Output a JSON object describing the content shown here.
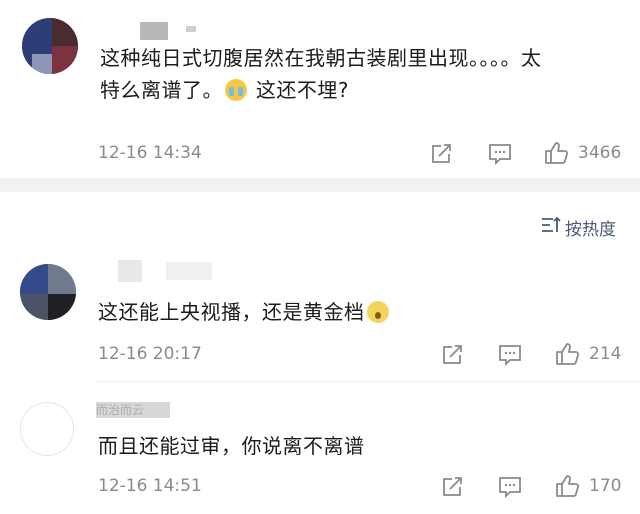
{
  "sort": {
    "label": "按热度"
  },
  "comments": [
    {
      "text_line1": "这种纯日式切腹居然在我朝古装剧里出现。。。。太",
      "text_line2a": "特么离谱了。",
      "text_line2b": " 这还不埋?",
      "time": "12-16 14:34",
      "likes": "3466"
    },
    {
      "text": "这还能上央视播，还是黄金档",
      "time": "12-16 20:17",
      "likes": "214"
    },
    {
      "username_partial": "而治而云",
      "text": "而且还能过审，你说离不离谱",
      "time": "12-16 14:51",
      "likes": "170"
    }
  ],
  "icons": {
    "share": "share-icon",
    "comment": "comment-icon",
    "like": "thumbs-up-icon",
    "sort": "sort-icon"
  }
}
